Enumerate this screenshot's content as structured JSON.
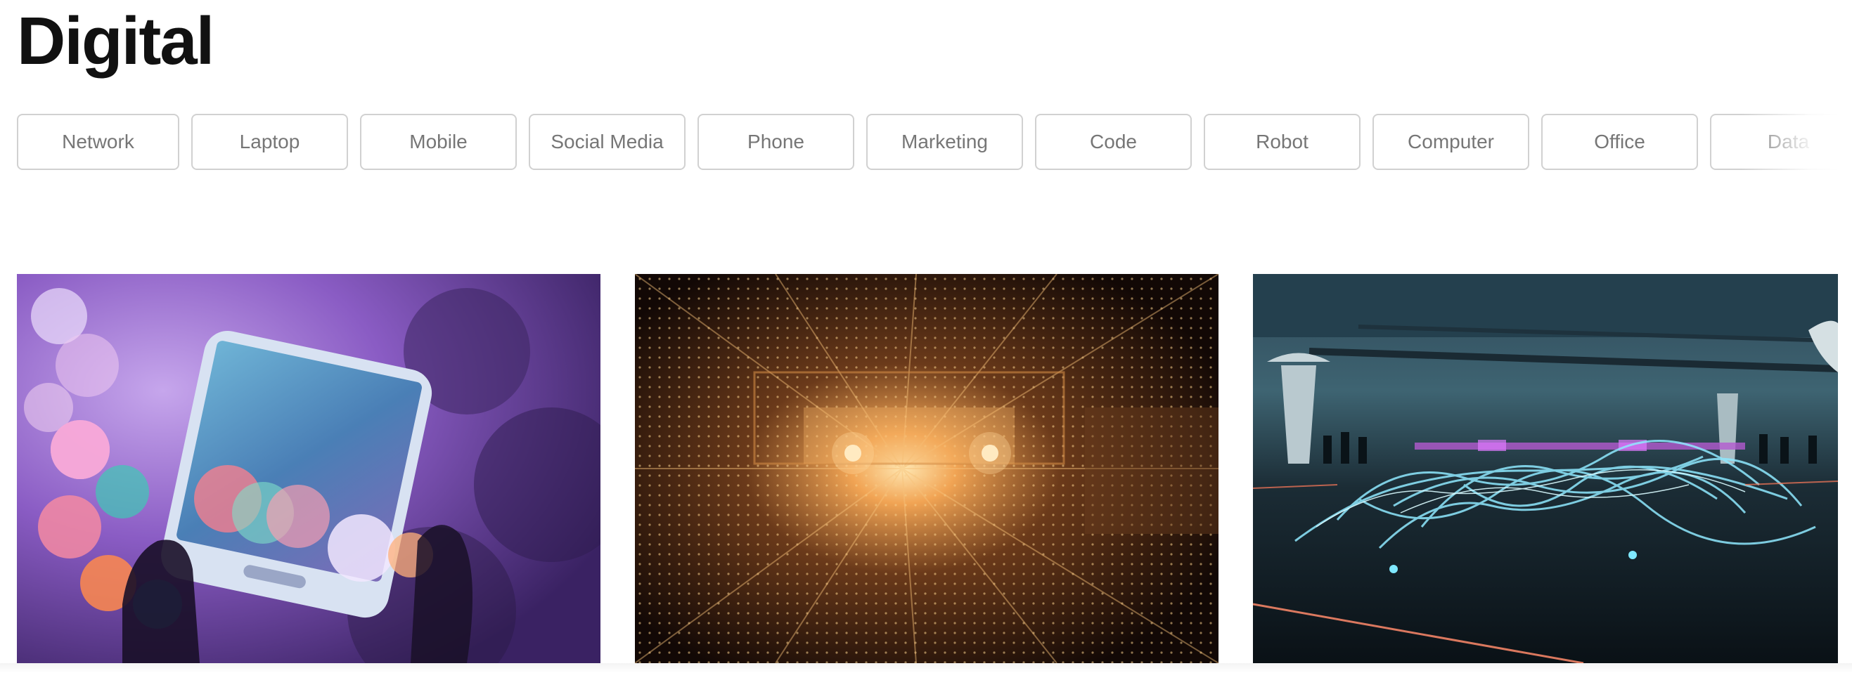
{
  "page": {
    "title": "Digital"
  },
  "tags": [
    {
      "label": "Network"
    },
    {
      "label": "Laptop"
    },
    {
      "label": "Mobile"
    },
    {
      "label": "Social Media"
    },
    {
      "label": "Phone"
    },
    {
      "label": "Marketing"
    },
    {
      "label": "Code"
    },
    {
      "label": "Robot"
    },
    {
      "label": "Computer"
    },
    {
      "label": "Office"
    },
    {
      "label": "Data"
    }
  ],
  "photos": [
    {
      "subject": "smartphone-bokeh-image"
    },
    {
      "subject": "light-tunnel-image"
    },
    {
      "subject": "light-painting-garage-image"
    }
  ]
}
